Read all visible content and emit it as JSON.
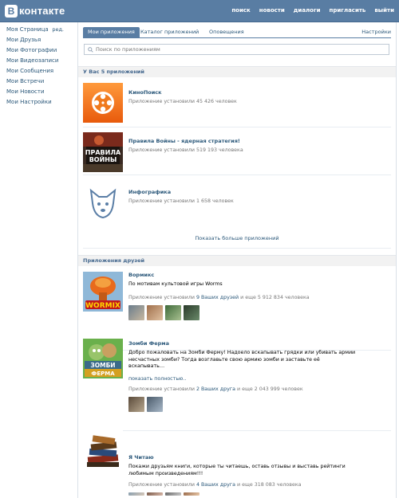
{
  "header": {
    "logo_letter": "В",
    "logo_text": "контакте",
    "nav": [
      "поиск",
      "новости",
      "диалоги",
      "пригласить",
      "выйти"
    ]
  },
  "leftnav": {
    "edit_label": "ред.",
    "items": [
      "Моя Страница",
      "Мои Друзья",
      "Мои Фотографии",
      "Мои Видеозаписи",
      "Мои Сообщения",
      "Мои Встречи",
      "Мои Новости",
      "Мои Настройки"
    ]
  },
  "tabs": {
    "items": [
      "Мои приложения",
      "Каталог приложений",
      "Оповещения"
    ],
    "settings": "Настройки"
  },
  "search": {
    "placeholder": "Поиск по приложениям",
    "value": ""
  },
  "my_apps": {
    "heading": "У Вас 5 приложений",
    "apps": [
      {
        "title": "КиноПоиск",
        "meta": "Приложение установили 45 426 человек"
      },
      {
        "title": "Правила Войны - ядерная стратегия!",
        "meta": "Приложение установили 519 193 человека"
      },
      {
        "title": "Инфографика",
        "meta": "Приложение установили 1 658 человек"
      }
    ],
    "show_more": "Показать больше приложений"
  },
  "friends_apps": {
    "heading": "Приложения друзей",
    "apps": [
      {
        "title": "Вормикс",
        "desc": "По мотивам культовой игры Worms",
        "meta_prefix": "Приложение установили ",
        "meta_link": "9 Ваших друзей",
        "meta_suffix": " и еще 5 912 834 человека"
      },
      {
        "title": "Зомби Ферма",
        "desc": "Добро пожаловать на Зомби Ферму! Надоело вскапывать грядки или убивать армии несчастных зомби? Тогда возглавьте свою армию зомби и заставьте её вскапывать…",
        "more": "показать полностью..",
        "meta_prefix": "Приложение установили ",
        "meta_link": "2 Ваших друга",
        "meta_suffix": " и еще 2 043 999 человек"
      },
      {
        "title": "Я Читаю",
        "desc": "Покажи друзьям книги, которые ты читаешь, оставь отзывы и выставь рейтинги любимым произведениям!!!",
        "meta_prefix": "Приложение установили ",
        "meta_link": "4 Ваших друга",
        "meta_suffix": " и еще 318 083 человека"
      }
    ]
  },
  "icons": {
    "kinopoisk": "film-reel-icon",
    "war": "war-game-icon",
    "infographic": "vk-dog-icon",
    "wormix": "wormix-icon",
    "zombie": "zombie-farm-icon",
    "books": "books-icon"
  },
  "colors": {
    "accent": "#597da3",
    "link": "#2b587a",
    "meta": "#777777",
    "section_bg": "#f2f2f2"
  }
}
